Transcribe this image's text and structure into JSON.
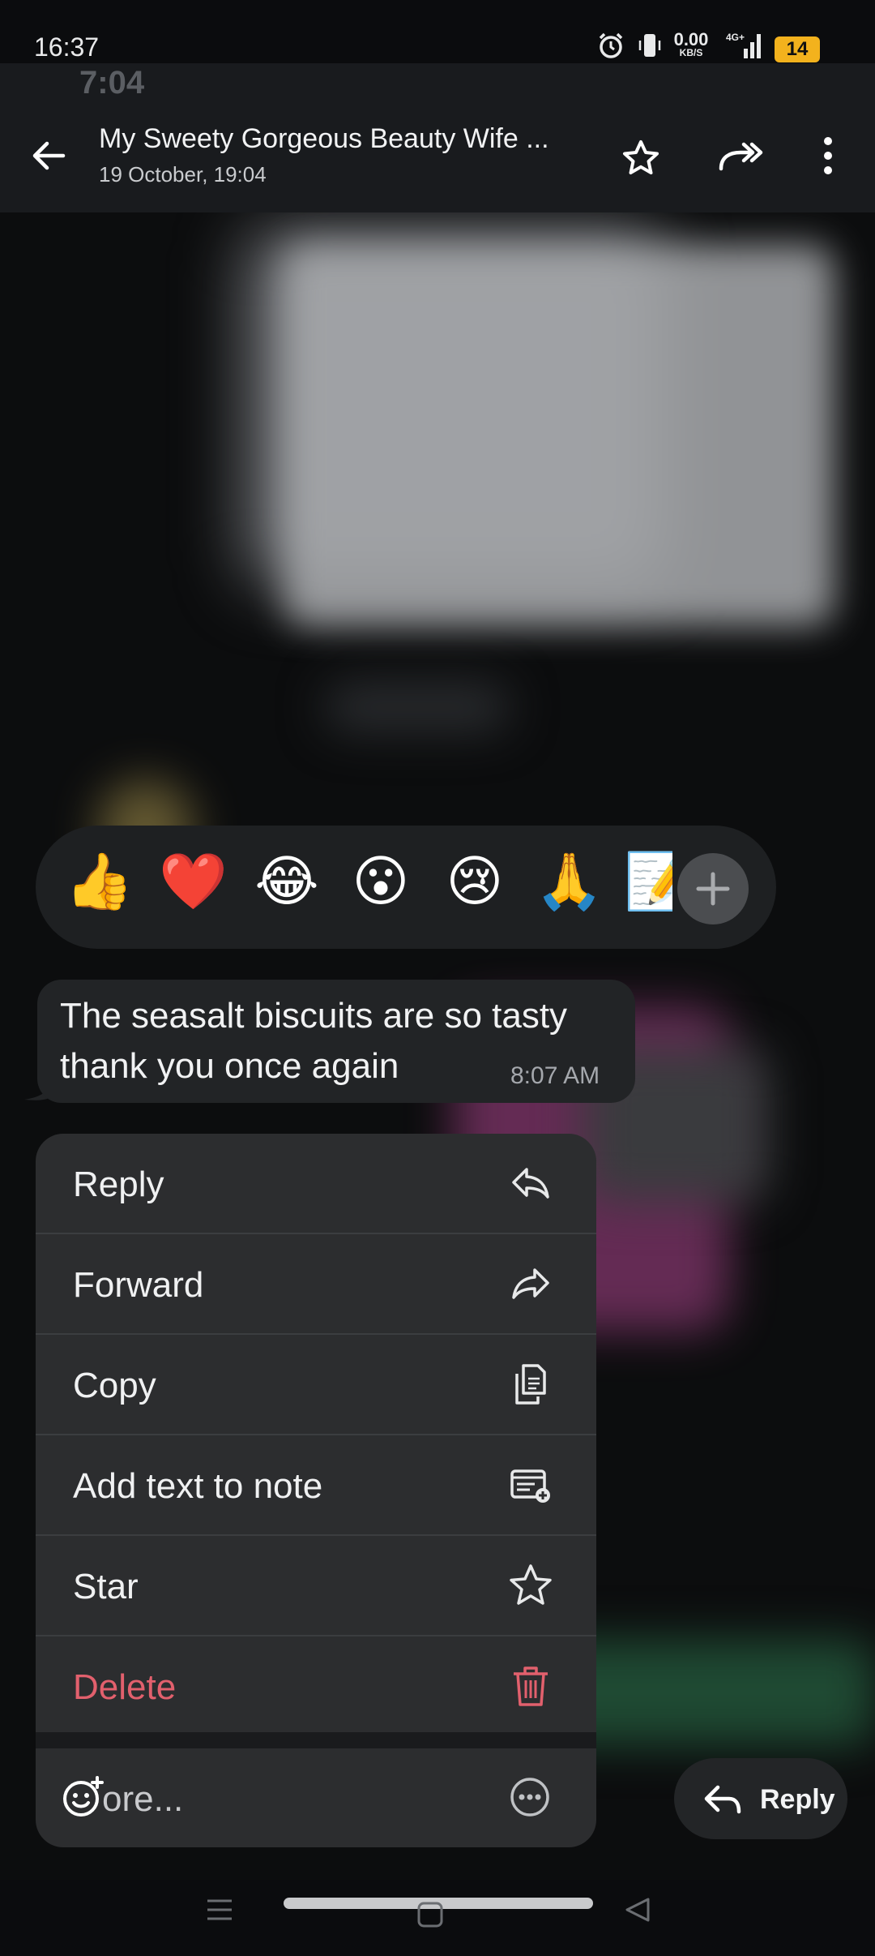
{
  "status_bar": {
    "time": "16:37",
    "net_speed_value": "0.00",
    "net_speed_unit": "KB/S",
    "network_type": "4G+",
    "battery_level": "14"
  },
  "ghost_time": "7:04",
  "header": {
    "title": "My Sweety Gorgeous Beauty Wife ...",
    "subtitle": "19 October, 19:04"
  },
  "reactions": {
    "emojis": [
      "👍",
      "❤️",
      "😂",
      "😮",
      "😢",
      "🙏",
      "📝"
    ],
    "add_icon": "plus-icon"
  },
  "message": {
    "text": "The seasalt biscuits are so tasty thank you once again",
    "time": "8:07 AM"
  },
  "menu": {
    "items": [
      {
        "label": "Reply",
        "icon": "reply-icon"
      },
      {
        "label": "Forward",
        "icon": "forward-icon"
      },
      {
        "label": "Copy",
        "icon": "copy-icon"
      },
      {
        "label": "Add text to note",
        "icon": "note-add-icon"
      },
      {
        "label": "Star",
        "icon": "star-icon"
      },
      {
        "label": "Delete",
        "icon": "trash-icon"
      }
    ],
    "more_label": "ore...",
    "delete_color": "#e2606d"
  },
  "reply_button": {
    "label": "Reply"
  },
  "colors": {
    "background": "#0c0d0e",
    "header": "#191b1e",
    "menu": "#2c2d2f",
    "battery": "#f3b21d"
  }
}
